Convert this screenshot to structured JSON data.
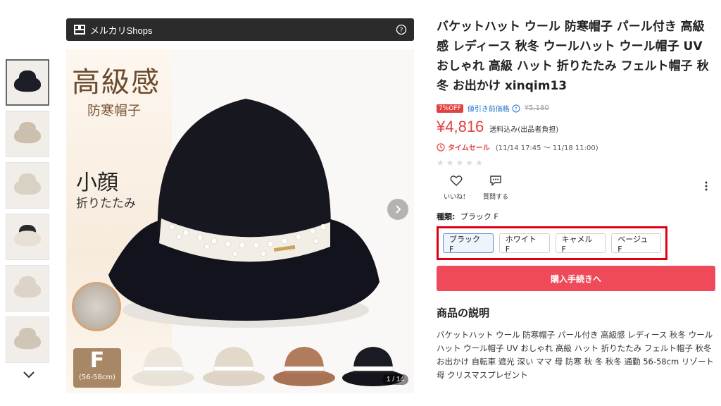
{
  "shop": {
    "name": "メルカリShops"
  },
  "gallery": {
    "counter": "1 / 14",
    "overlay": {
      "headline": "高級感",
      "subtitle": "防寒帽子",
      "face_text": "小顔",
      "fold_text": "折りたたみ",
      "size_letter": "F",
      "size_range": "(56-58cm)"
    },
    "thumbnail_count": 6
  },
  "product": {
    "title": "バケットハット ウール 防寒帽子 パール付き 高級感 レディース 秋冬 ウールハット ウール帽子 UV おしゃれ 高級 ハット 折りたたみ フェルト帽子 秋冬 お出かけ xinqim13",
    "off_badge": "7%OFF",
    "discount_label": "値引き前価格",
    "old_price": "¥5,180",
    "price": "¥4,816",
    "shipping": "送料込み(出品者負担)",
    "sale_label": "タイムセール",
    "sale_period": "(11/14 17:45 〜 11/18 11:00)",
    "like_label": "いいね！",
    "question_label": "質問する",
    "type_label": "種類:",
    "type_value": "ブラック F",
    "variants": [
      "ブラック F",
      "ホワイト F",
      "キャメル F",
      "ベージュ F"
    ],
    "buy_button": "購入手続きへ",
    "description_heading": "商品の説明",
    "description": "バケットハット ウール 防寒帽子 パール付き 高級感 レディース 秋冬 ウールハット ウール帽子 UV おしゃれ 高級 ハット 折りたたみ フェルト帽子 秋冬 お出かけ 自転車 遮光 深い ママ 母 防寒 秋 冬 秋冬 通勤 56-58cm リゾート 母 クリスマスプレゼント"
  },
  "colors": {
    "accent": "#e24141",
    "buy": "#ef4a5a",
    "highlight_box": "#e00012",
    "link": "#2673c8"
  }
}
